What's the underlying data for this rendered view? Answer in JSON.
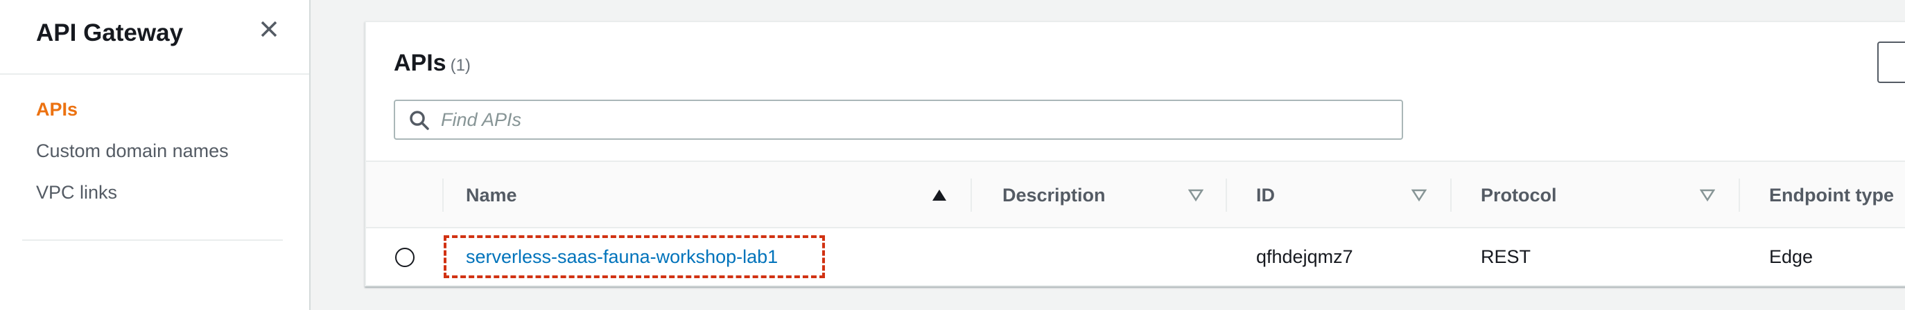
{
  "sidebar": {
    "title": "API Gateway",
    "items": [
      {
        "label": "APIs",
        "active": true
      },
      {
        "label": "Custom domain names",
        "active": false
      },
      {
        "label": "VPC links",
        "active": false
      }
    ]
  },
  "panel": {
    "title": "APIs",
    "count": "(1)",
    "search": {
      "placeholder": "Find APIs",
      "value": ""
    }
  },
  "table": {
    "columns": [
      "Name",
      "Description",
      "ID",
      "Protocol",
      "Endpoint type"
    ],
    "rows": [
      {
        "name": "serverless-saas-fauna-workshop-lab1",
        "description": "",
        "id": "qfhdejqmz7",
        "protocol": "REST",
        "endpoint_type": "Edge"
      }
    ]
  },
  "icons": {
    "close": "close-icon",
    "search": "search-icon",
    "sort_asc": "sort-ascending-icon",
    "sort": "sort-descending-outline-icon"
  },
  "colors": {
    "accent": "#ec7211",
    "link": "#0073bb",
    "highlight": "#d13212"
  }
}
